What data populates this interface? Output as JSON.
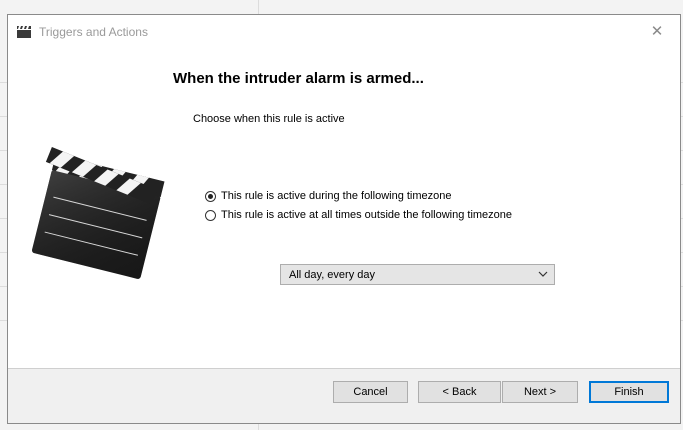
{
  "window": {
    "title": "Triggers and Actions",
    "close_glyph": "✕"
  },
  "page": {
    "heading": "When the intruder alarm is armed...",
    "subtext": "Choose when this rule is active",
    "illustration_icon": "clapperboard-icon"
  },
  "options": [
    {
      "label": "This rule is active during the following timezone",
      "checked": true
    },
    {
      "label": "This rule is active at all times outside the following timezone",
      "checked": false
    }
  ],
  "timezone_select": {
    "value": "All day, every day"
  },
  "buttons": {
    "cancel": "Cancel",
    "back": "< Back",
    "next": "Next >",
    "finish": "Finish"
  },
  "colors": {
    "accent": "#0078d7",
    "footer_bg": "#f0f0f0",
    "title_text": "#9a9a9a"
  }
}
